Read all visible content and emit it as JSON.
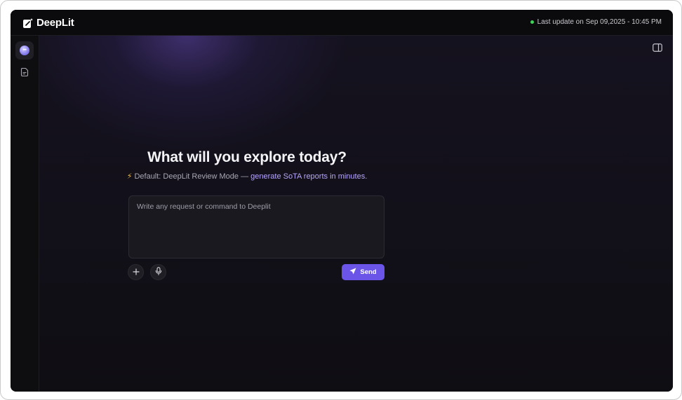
{
  "app": {
    "name": "DeepLit"
  },
  "header": {
    "status_text": "Last update on Sep 09,2025 - 10:45 PM",
    "status_color": "#3fd15b"
  },
  "sidebar": {
    "items": [
      {
        "icon": "assistant-orb-icon",
        "active": true
      },
      {
        "icon": "document-icon",
        "active": false
      }
    ]
  },
  "main": {
    "headline": "What will you explore today?",
    "mode_prefix": "Default: DeepLit Review Mode —",
    "mode_highlight": "generate SoTA reports in minutes.",
    "prompt": {
      "placeholder": "Write any request or command to Deeplit",
      "value": ""
    },
    "actions": {
      "add_icon": "plus-icon",
      "mic_icon": "microphone-icon",
      "send_label": "Send"
    }
  },
  "colors": {
    "accent": "#6a55e8",
    "highlight_text": "#b6a6ff",
    "bolt": "#f2b93b"
  }
}
